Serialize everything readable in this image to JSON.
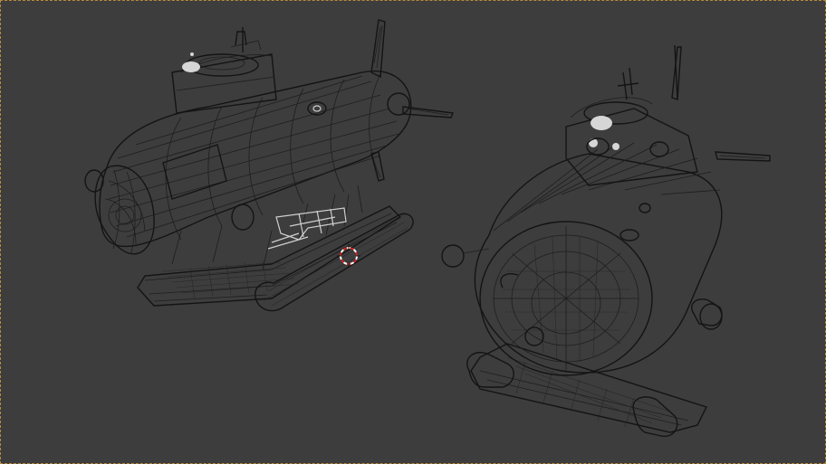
{
  "viewport": {
    "label": "3D Viewport",
    "shading": "wireframe",
    "background_color": "#3d3d3d",
    "wire_color": "#1c1c1c",
    "highlight_color": "#d6d6d6",
    "border_color": "#b88a3a"
  },
  "scene": {
    "objects": [
      {
        "name": "submarine-side-view",
        "icon": "wireframe-mesh"
      },
      {
        "name": "submarine-front-view",
        "icon": "wireframe-mesh"
      }
    ],
    "cursor_icon": "3d-cursor-icon",
    "cursor_colors": [
      "#d42020",
      "#ffffff"
    ]
  }
}
